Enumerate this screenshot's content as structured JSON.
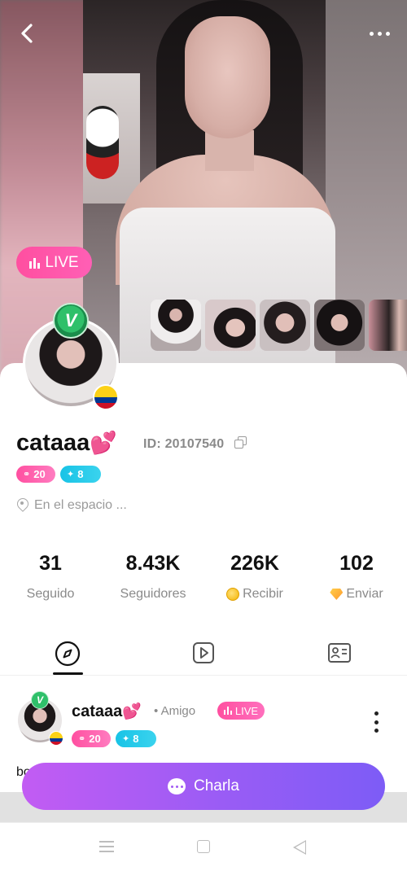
{
  "header": {
    "back_icon": "chevron-left-icon",
    "more_icon": "more-horizontal-icon"
  },
  "hero": {
    "live_label": "LIVE",
    "thumbnails_count": 5
  },
  "profile": {
    "name": "cataaa",
    "name_emoji": "💕",
    "id_text": "ID: 20107540",
    "levels": [
      {
        "value": "20",
        "icon": "link-icon",
        "color": "#ff4fa0"
      },
      {
        "value": "8",
        "icon": "sprout-icon",
        "color": "#18c3e6"
      }
    ],
    "location": "En el espacio ...",
    "country_flag": "colombia-flag"
  },
  "stats": [
    {
      "value": "31",
      "label": "Seguido"
    },
    {
      "value": "8.43K",
      "label": "Seguidores"
    },
    {
      "value": "226K",
      "label": "Recibir",
      "icon": "coin-icon"
    },
    {
      "value": "102",
      "label": "Enviar",
      "icon": "gem-icon"
    }
  ],
  "tabs": [
    {
      "name": "explore",
      "icon": "compass-icon",
      "active": true
    },
    {
      "name": "videos",
      "icon": "play-icon",
      "active": false
    },
    {
      "name": "profile-card",
      "icon": "id-card-icon",
      "active": false
    }
  ],
  "post": {
    "name": "cataaa",
    "name_emoji": "💕",
    "relation": "• Amigo",
    "live_label": "LIVE",
    "levels": [
      {
        "value": "20",
        "icon": "link-icon"
      },
      {
        "value": "8",
        "icon": "sprout-icon"
      }
    ],
    "text_fragment": "bo"
  },
  "cta": {
    "label": "Charla",
    "icon": "chat-bubble-icon"
  },
  "colors": {
    "accent_pink": "#ff4fa0",
    "accent_cyan": "#18c3e6",
    "cta_gradient_start": "#c25cf3",
    "cta_gradient_end": "#7d5cf6"
  }
}
